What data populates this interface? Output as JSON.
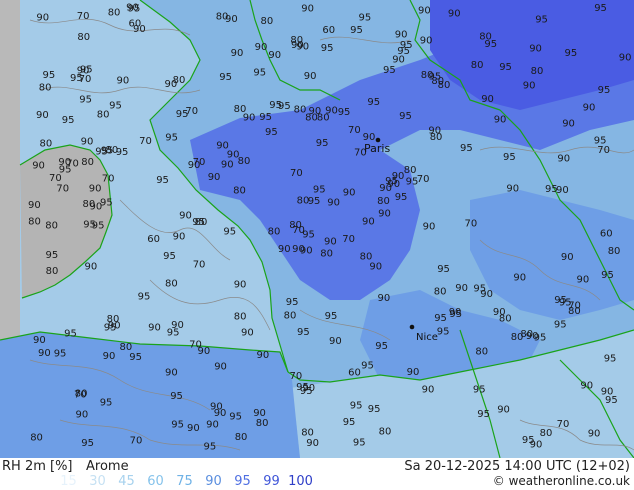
{
  "header": {
    "variable": "RH 2m [%]",
    "model": "Arome",
    "valid_time": "Sa 20-12-2025 14:00 UTC (12+02)",
    "copyright": "© weatheronline.co.uk"
  },
  "legend": {
    "values": [
      "15",
      "30",
      "45",
      "60",
      "75",
      "90",
      "95",
      "99",
      "100"
    ],
    "colors": [
      "#e6f2fb",
      "#c6e1f3",
      "#a7d2ee",
      "#86c3eb",
      "#6fb2e6",
      "#5b8fdf",
      "#4f6fe2",
      "#3f55d8",
      "#2f3fc8"
    ]
  },
  "map": {
    "colors": {
      "sea": "#a4cbe8",
      "land": "#85b6e3",
      "land_humid": "#6e9ee6",
      "humid": "#5a78e6",
      "very_humid": "#4a5ce3",
      "uk_land": "#b4b4b4",
      "outside": "#b9b9b9",
      "coast": "#1aa31a",
      "contour": "#8a8a8a"
    },
    "cities": [
      {
        "name": "Paris"
      },
      {
        "name": "Nice"
      }
    ],
    "contour_labels": [
      "80",
      "80",
      "70",
      "80",
      "90",
      "90",
      "90",
      "90",
      "95",
      "90",
      "90",
      "90",
      "95",
      "95",
      "90",
      "90",
      "70",
      "80",
      "70",
      "80",
      "80",
      "90",
      "95",
      "90",
      "90",
      "90",
      "95",
      "90",
      "70",
      "80",
      "70",
      "80",
      "70",
      "80",
      "70",
      "80",
      "70",
      "80",
      "90",
      "95",
      "95",
      "90",
      "95",
      "95",
      "90",
      "90",
      "80",
      "95",
      "95",
      "90",
      "90",
      "90",
      "95",
      "95",
      "90",
      "90",
      "60",
      "70",
      "60",
      "80",
      "60",
      "80",
      "70",
      "95",
      "95",
      "90",
      "95",
      "90",
      "95",
      "90",
      "95",
      "95",
      "90",
      "90",
      "70",
      "80",
      "70",
      "80",
      "70",
      "95",
      "90",
      "95",
      "90",
      "70",
      "80",
      "90",
      "95",
      "90",
      "95",
      "90",
      "80",
      "80",
      "70",
      "80",
      "90",
      "95",
      "95",
      "90",
      "80",
      "80",
      "60",
      "80",
      "60",
      "70",
      "95",
      "95",
      "90",
      "95",
      "90",
      "80",
      "90",
      "70",
      "80",
      "80",
      "90",
      "95",
      "90",
      "95",
      "95",
      "80",
      "95",
      "95",
      "70",
      "80",
      "70",
      "80",
      "70",
      "80",
      "90",
      "95",
      "90",
      "80",
      "70",
      "95",
      "90",
      "80",
      "70",
      "80",
      "95",
      "90",
      "80",
      "70",
      "80",
      "70",
      "90",
      "95",
      "90",
      "95",
      "95",
      "90",
      "90",
      "95",
      "90",
      "80",
      "90",
      "95",
      "90",
      "95",
      "90",
      "95",
      "90",
      "95",
      "80",
      "90",
      "95",
      "90",
      "95",
      "90",
      "95",
      "90",
      "95",
      "95",
      "80",
      "90",
      "80",
      "90",
      "95",
      "95",
      "90",
      "95",
      "95",
      "90",
      "95",
      "80",
      "90",
      "95",
      "95",
      "90",
      "90",
      "95",
      "95",
      "90",
      "80",
      "90",
      "95",
      "90",
      "95",
      "95",
      "90",
      "90",
      "90",
      "80",
      "95",
      "90",
      "95",
      "80",
      "90",
      "90",
      "80",
      "95",
      "95",
      "90",
      "90",
      "80",
      "95",
      "90",
      "95",
      "90",
      "90",
      "80",
      "90",
      "95",
      "80",
      "95",
      "95",
      "90",
      "95",
      "90",
      "80",
      "95",
      "90",
      "80",
      "95",
      "90",
      "95",
      "90",
      "90",
      "95",
      "95",
      "90",
      "95",
      "95",
      "90",
      "80",
      "90",
      "95",
      "95",
      "90",
      "80",
      "95",
      "95",
      "90",
      "95",
      "90",
      "95",
      "90",
      "80",
      "95",
      "90",
      "80",
      "90",
      "95",
      "95",
      "90",
      "95",
      "95",
      "90",
      "80",
      "90",
      "95",
      "90",
      "80",
      "95",
      "90",
      "95"
    ]
  }
}
